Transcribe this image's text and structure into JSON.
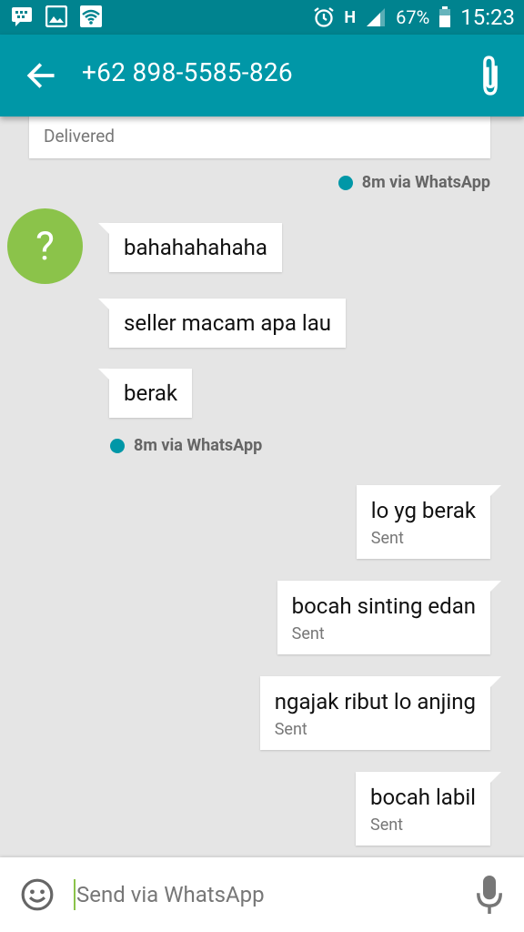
{
  "status_bar": {
    "battery": "67%",
    "time": "15:23",
    "network": "H",
    "icons": [
      "bbm-icon",
      "gallery-icon",
      "wifi-icon",
      "alarm-icon",
      "signal-icon",
      "battery-icon"
    ]
  },
  "header": {
    "title": "+62 898-5585-826",
    "back_icon": "arrow-left-icon",
    "attach_icon": "paperclip-icon"
  },
  "messages": [
    {
      "direction": "outgoing",
      "text": "",
      "status": "Delivered"
    },
    {
      "direction": "incoming",
      "text": "bahahahahaha"
    },
    {
      "direction": "incoming",
      "text": "seller macam apa lau"
    },
    {
      "direction": "incoming",
      "text": "berak"
    },
    {
      "direction": "outgoing",
      "text": "lo yg berak",
      "status": "Sent"
    },
    {
      "direction": "outgoing",
      "text": "bocah sinting edan",
      "status": "Sent"
    },
    {
      "direction": "outgoing",
      "text": "ngajak ribut lo anjing",
      "status": "Sent"
    },
    {
      "direction": "outgoing",
      "text": "bocah labil",
      "status": "Sent"
    }
  ],
  "meta_lines": [
    "8m via WhatsApp",
    "8m via WhatsApp"
  ],
  "avatar": {
    "glyph": "?",
    "color": "#8bc34a"
  },
  "compose": {
    "placeholder": "Send via WhatsApp",
    "value": "",
    "emoji_icon": "smiley-icon",
    "mic_icon": "microphone-icon"
  },
  "colors": {
    "status_bar": "#00838f",
    "toolbar": "#0097a7",
    "background": "#e5e5e5",
    "accent_dot": "#0097a7"
  }
}
